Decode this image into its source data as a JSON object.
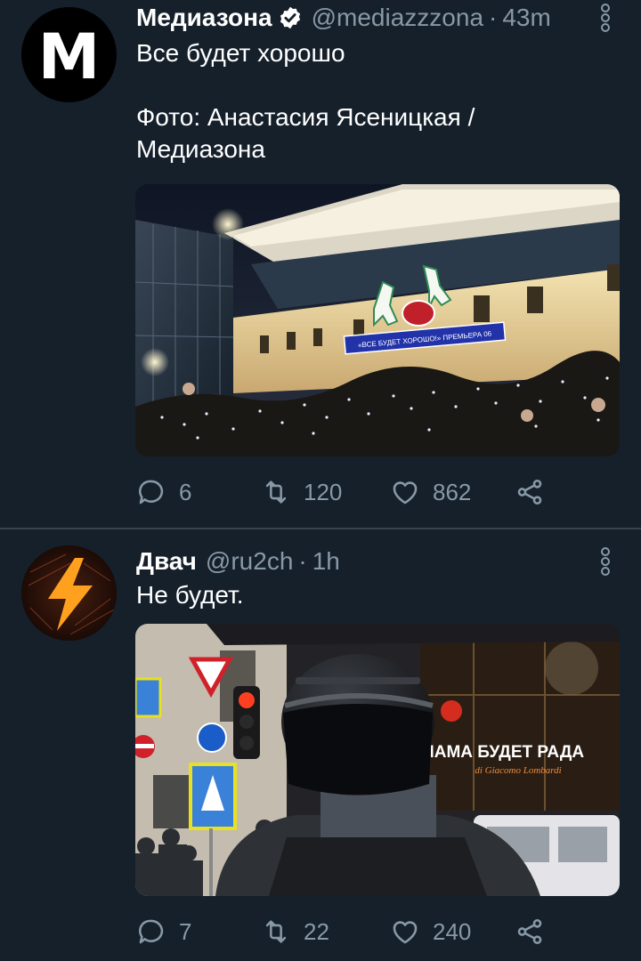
{
  "tweets": [
    {
      "author_name": "Медиазона",
      "avatar_letter": "M",
      "verified": true,
      "handle": "@mediazzzona",
      "separator": "·",
      "time": "43m",
      "text": "Все будет хорошо\n\nФото: Анастасия Ясеницкая /\nМедиазона",
      "image_sign_text": "«ВСЕ БУДЕТ ХОРОШО!» ПРЕМЬЕРА 06",
      "replies": "6",
      "retweets": "120",
      "likes": "862"
    },
    {
      "author_name": "Двач",
      "verified": false,
      "handle": "@ru2ch",
      "separator": "·",
      "time": "1h",
      "text": "Не будет.",
      "image_sign_text": "МАМА БУДЕТ РАДА",
      "image_sign_script": "di Giacomo Lombardi",
      "replies": "7",
      "retweets": "22",
      "likes": "240"
    }
  ],
  "colors": {
    "background": "#15202b",
    "secondary_text": "#8899a6",
    "divider": "#38444d",
    "accent": "#1da1f2"
  },
  "icons": [
    "reply-icon",
    "retweet-icon",
    "like-icon",
    "share-icon",
    "more-icon",
    "verified-badge-icon"
  ]
}
